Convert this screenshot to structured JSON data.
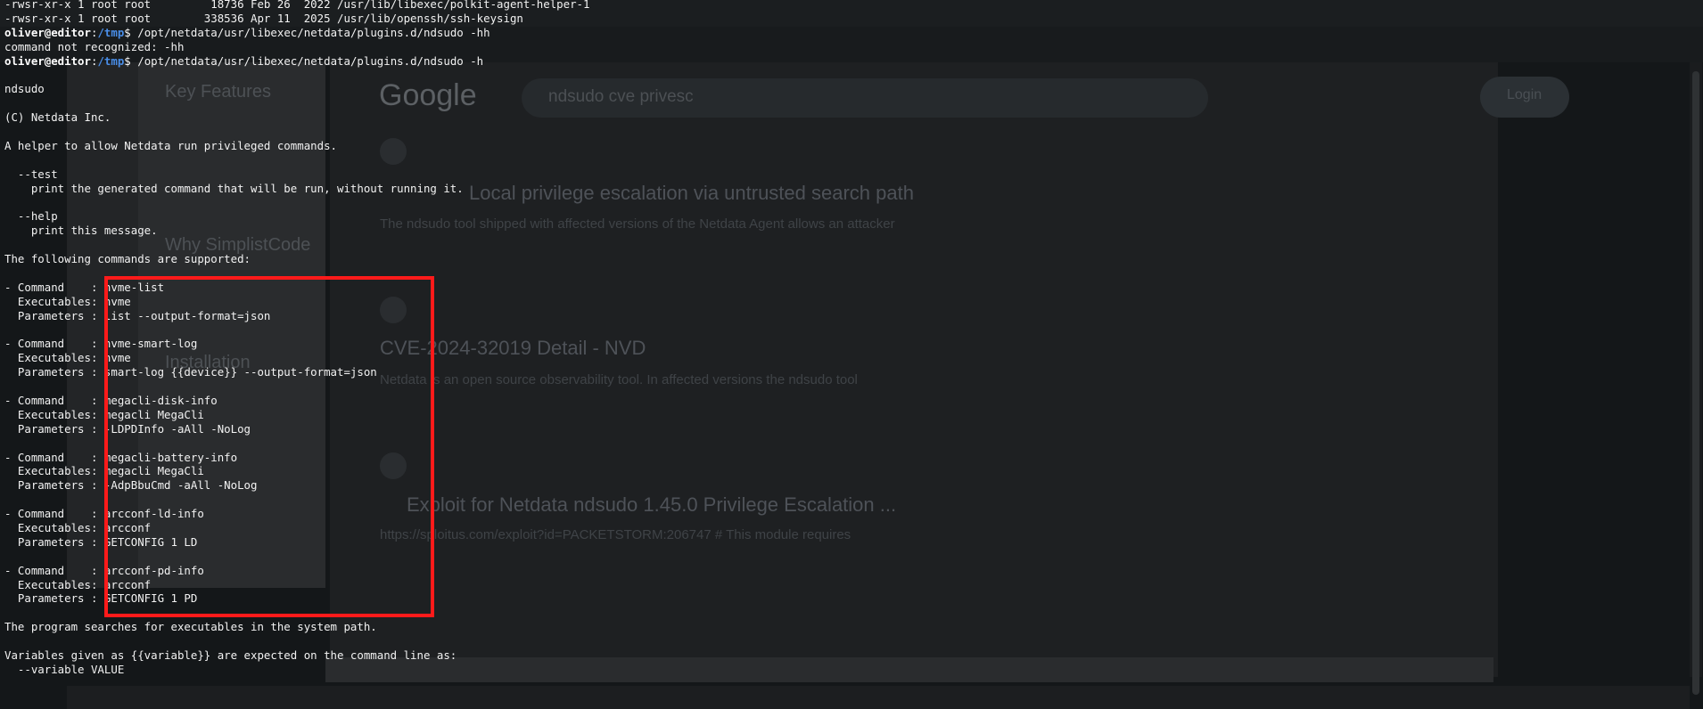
{
  "background_browser": {
    "search_query": "ndsudo cve privesc",
    "login_button": "Login",
    "logo": "Google",
    "result_titles": [
      "Local privilege escalation via untrusted search path",
      "CVE-2024-32019 Detail - NVD",
      "Exploit for Netdata ndsudo 1.45.0 Privilege Escalation ..."
    ],
    "result_snippets": [
      "The ndsudo tool shipped with affected versions of the Netdata Agent allows an attacker",
      "Netdata is an open source observability tool. In affected versions the ndsudo tool",
      "https://sploitus.com/exploit?id=PACKETSTORM:206747 # This module requires"
    ],
    "left_headings": [
      "Key Features",
      "Why SimplistCode",
      "Installation"
    ]
  },
  "terminal": {
    "prompt": {
      "user_host": "oliver@editor",
      "path": "/tmp",
      "symbol": "$"
    },
    "lines": [
      "-rwsr-xr-x 1 root root         18736 Feb 26  2022 /usr/lib/libexec/polkit-agent-helper-1",
      "-rwsr-xr-x 1 root root        338536 Apr 11  2025 /usr/lib/openssh/ssh-keysign",
      "",
      "command not recognized: -hh",
      "",
      "",
      "ndsudo",
      "",
      "(C) Netdata Inc.",
      "",
      "A helper to allow Netdata run privileged commands.",
      "",
      "  --test",
      "    print the generated command that will be run, without running it.",
      "",
      "  --help",
      "    print this message.",
      "",
      "The following commands are supported:",
      "",
      "- Command    : nvme-list",
      "  Executables: nvme",
      "  Parameters : list --output-format=json",
      "",
      "- Command    : nvme-smart-log",
      "  Executables: nvme",
      "  Parameters : smart-log {{device}} --output-format=json",
      "",
      "- Command    : megacli-disk-info",
      "  Executables: megacli MegaCli",
      "  Parameters : -LDPDInfo -aAll -NoLog",
      "",
      "- Command    : megacli-battery-info",
      "  Executables: megacli MegaCli",
      "  Parameters : -AdpBbuCmd -aAll -NoLog",
      "",
      "- Command    : arcconf-ld-info",
      "  Executables: arcconf",
      "  Parameters : GETCONFIG 1 LD",
      "",
      "- Command    : arcconf-pd-info",
      "  Executables: arcconf",
      "  Parameters : GETCONFIG 1 PD",
      "",
      "The program searches for executables in the system path.",
      "",
      "Variables given as {{variable}} are expected on the command line as:",
      "  --variable VALUE"
    ],
    "commands": [
      "/opt/netdata/usr/libexec/netdata/plugins.d/ndsudo -hh",
      "/opt/netdata/usr/libexec/netdata/plugins.d/ndsudo -h"
    ]
  },
  "colors": {
    "prompt_path": "#4a8ee8",
    "highlight_box": "#ff1a1a",
    "text": "#f2f2f2"
  }
}
